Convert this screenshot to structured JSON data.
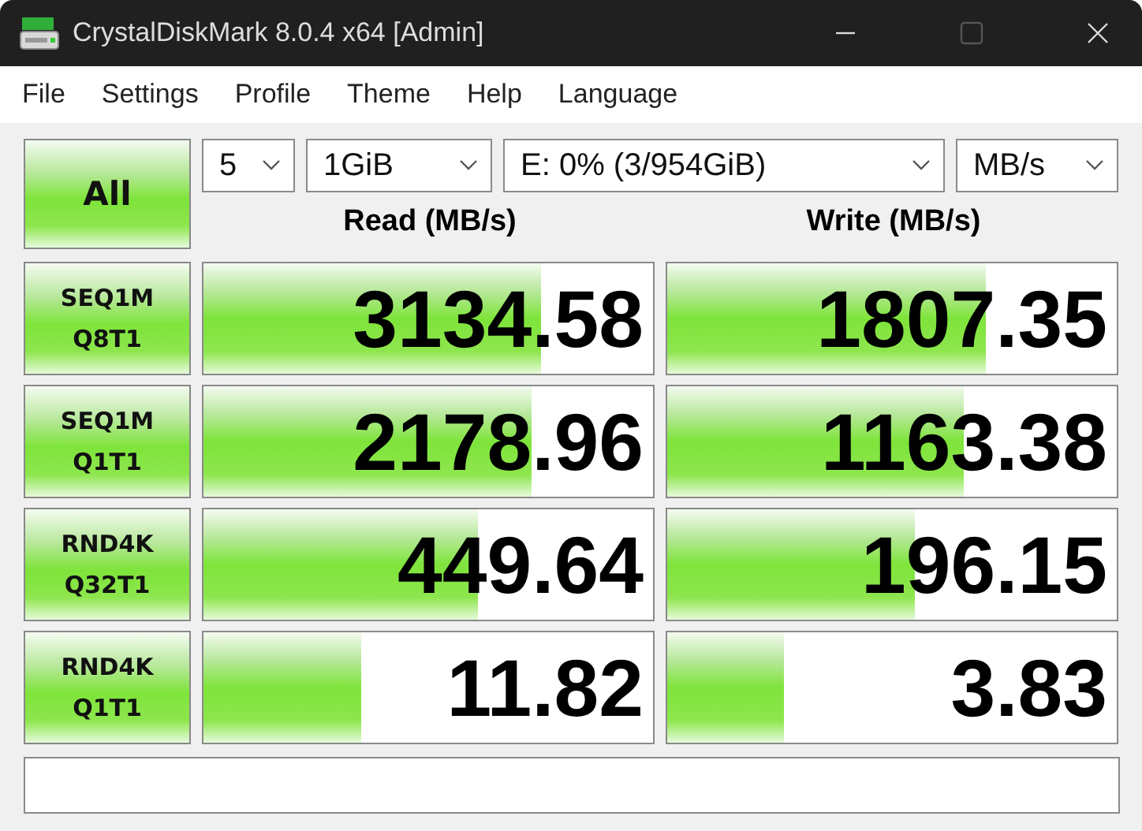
{
  "window": {
    "title": "CrystalDiskMark 8.0.4 x64 [Admin]"
  },
  "menu": [
    "File",
    "Settings",
    "Profile",
    "Theme",
    "Help",
    "Language"
  ],
  "all_button": "All",
  "selects": [
    {
      "value": "5"
    },
    {
      "value": "1GiB"
    },
    {
      "value": "E: 0% (3/954GiB)"
    },
    {
      "value": "MB/s"
    }
  ],
  "headers": {
    "read": "Read (MB/s)",
    "write": "Write (MB/s)"
  },
  "rows": [
    {
      "label": [
        "SEQ1M",
        "Q8T1"
      ],
      "read": {
        "value": "3134.58",
        "level": 0.75
      },
      "write": {
        "value": "1807.35",
        "level": 0.71
      }
    },
    {
      "label": [
        "SEQ1M",
        "Q1T1"
      ],
      "read": {
        "value": "2178.96",
        "level": 0.73
      },
      "write": {
        "value": "1163.38",
        "level": 0.66
      }
    },
    {
      "label": [
        "RND4K",
        "Q32T1"
      ],
      "read": {
        "value": "449.64",
        "level": 0.61
      },
      "write": {
        "value": "196.15",
        "level": 0.55
      }
    },
    {
      "label": [
        "RND4K",
        "Q1T1"
      ],
      "read": {
        "value": "11.82",
        "level": 0.35
      },
      "write": {
        "value": "3.83",
        "level": 0.26
      }
    }
  ]
}
